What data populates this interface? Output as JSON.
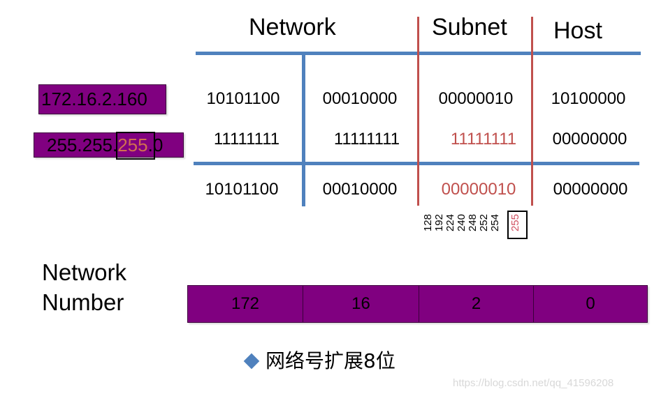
{
  "headers": {
    "network": "Network",
    "subnet": "Subnet",
    "host": "Host"
  },
  "ip_address": "172.16.2.160",
  "subnet_mask": {
    "prefix": "255.255.",
    "highlight": "255",
    "suffix": ".0"
  },
  "rows": {
    "address_bits": [
      "10101100",
      "00010000",
      "00000010",
      "10100000"
    ],
    "mask_bits": [
      "11111111",
      "11111111",
      "11111111",
      "00000000"
    ],
    "result_bits": [
      "10101100",
      "00010000",
      "00000010",
      "00000000"
    ]
  },
  "mask_values": [
    "128",
    "192",
    "224",
    "240",
    "248",
    "252",
    "254",
    "255"
  ],
  "network_number": {
    "label_line1": "Network",
    "label_line2": "Number",
    "octets": [
      "172",
      "16",
      "2",
      "0"
    ]
  },
  "caption": "网络号扩展8位",
  "watermark": "https://blog.csdn.net/qq_41596208",
  "colors": {
    "blue_line": "#4f81bd",
    "red_line": "#c0504d",
    "purple_box": "#800080"
  }
}
